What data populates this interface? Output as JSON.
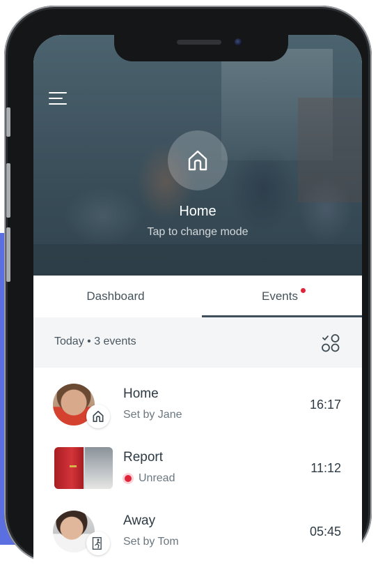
{
  "colors": {
    "accent_background": "#5b6fe0",
    "tab_underline": "#3e4e5a",
    "unread": "#e0243a",
    "text_primary": "#2d3a43",
    "text_secondary": "#6b7780"
  },
  "hero": {
    "menu_icon": "hamburger-menu-icon",
    "mode_icon": "house-icon",
    "mode_title": "Home",
    "mode_subtitle": "Tap to change mode"
  },
  "tabs": [
    {
      "label": "Dashboard",
      "active": false
    },
    {
      "label": "Events",
      "active": true,
      "has_notification": true
    }
  ],
  "events_header": {
    "label": "Today • 3 events",
    "filter_icon": "filter-icon"
  },
  "events": [
    {
      "title": "Home",
      "subtitle": "Set by Jane",
      "time": "16:17",
      "badge_icon": "house-icon",
      "thumbnail": "jane-avatar"
    },
    {
      "title": "Report",
      "subtitle": "Unread",
      "time": "11:12",
      "status": "unread",
      "thumbnail": "door-camera-snapshot"
    },
    {
      "title": "Away",
      "subtitle": "Set by Tom",
      "time": "05:45",
      "badge_icon": "person-exit-icon",
      "thumbnail": "tom-avatar"
    }
  ]
}
